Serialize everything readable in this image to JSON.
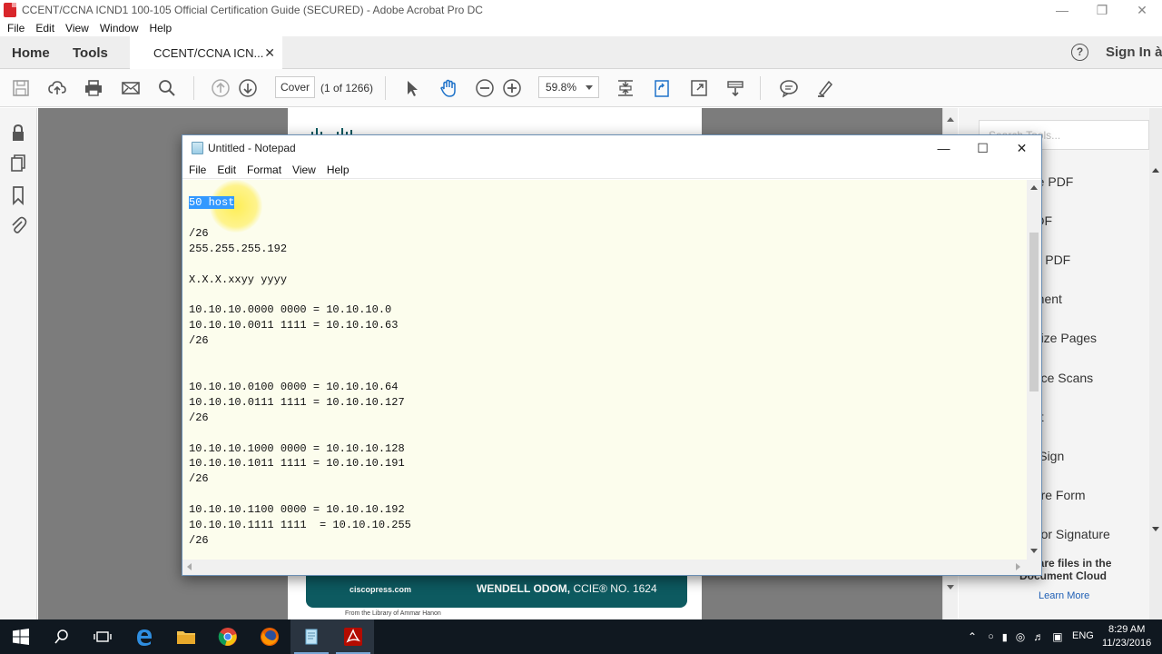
{
  "acrobat": {
    "title": "CCENT/CCNA ICND1 100-105 Official Certification Guide (SECURED) - Adobe Acrobat Pro DC",
    "menu": [
      "File",
      "Edit",
      "View",
      "Window",
      "Help"
    ],
    "tabs": {
      "home": "Home",
      "tools": "Tools",
      "doc": "CCENT/CCNA ICN..."
    },
    "sign_in": "Sign In à",
    "page_field": "Cover",
    "page_count": "(1 of 1266)",
    "zoom": "59.8%",
    "right_tools": {
      "search_placeholder": "Search Tools...",
      "items": [
        "ate PDF",
        "PDF",
        "ort PDF",
        "nment",
        "anize Pages",
        "ance Scans",
        "ect",
        "& Sign",
        "pare Form",
        "d for Signature"
      ],
      "share_line1": "l share files in the",
      "share_line2": "Document Cloud",
      "learn_more": "Learn More"
    },
    "cover": {
      "site": "ciscopress.com",
      "author": "WENDELL ODOM,",
      "credential": " CCIE® NO. 1624",
      "library": "From the Library of Ammar Hanon"
    }
  },
  "notepad": {
    "title": "Untitled - Notepad",
    "menu": [
      "File",
      "Edit",
      "Format",
      "View",
      "Help"
    ],
    "selected_text": "50 host",
    "body": "\n\n/26\n255.255.255.192\n\nX.X.X.xxyy yyyy\n\n10.10.10.0000 0000 = 10.10.10.0\n10.10.10.0011 1111 = 10.10.10.63\n/26\n\n\n10.10.10.0100 0000 = 10.10.10.64\n10.10.10.0111 1111 = 10.10.10.127\n/26\n\n10.10.10.1000 0000 = 10.10.10.128\n10.10.10.1011 1111 = 10.10.10.191\n/26\n\n10.10.10.1100 0000 = 10.10.10.192\n10.10.10.1111 1111  = 10.10.10.255\n/26"
  },
  "taskbar": {
    "lang": "ENG",
    "time": "8:29 AM",
    "date": "11/23/2016"
  },
  "colors": {
    "selection": "#3399ff",
    "notepad_bg": "#fcfded",
    "cover_bar": "#0d5a60",
    "taskbar": "#101820"
  }
}
